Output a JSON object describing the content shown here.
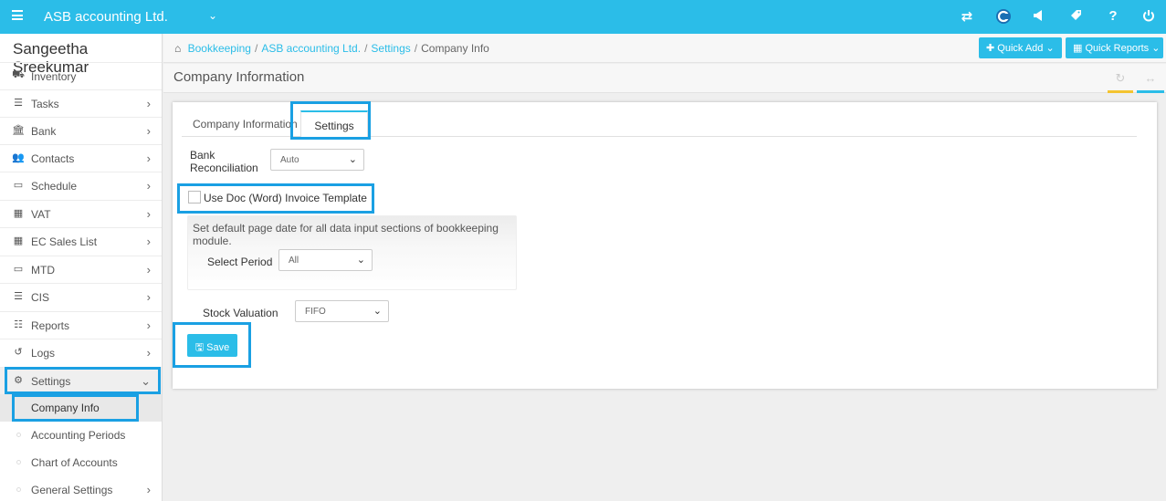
{
  "app": {
    "company": "ASB accounting Ltd.",
    "caret": "⌄",
    "menu_icon": "hamburger-icon",
    "top_icons": [
      "swap-icon",
      "c-logo-icon",
      "megaphone-icon",
      "tag-icon",
      "help-icon",
      "power-icon"
    ],
    "accent": "#2bbde8"
  },
  "sidebar": {
    "user": "Sangeetha Sreekumar",
    "items": [
      {
        "label": "Inventory",
        "icon": "truck-icon",
        "arrow": ""
      },
      {
        "label": "Tasks",
        "icon": "tasks-icon",
        "arrow": "›"
      },
      {
        "label": "Bank",
        "icon": "bank-icon",
        "arrow": "›"
      },
      {
        "label": "Contacts",
        "icon": "users-icon",
        "arrow": "›"
      },
      {
        "label": "Schedule",
        "icon": "calendar-icon",
        "arrow": "›"
      },
      {
        "label": "VAT",
        "icon": "calculator-icon",
        "arrow": "›"
      },
      {
        "label": "EC Sales List",
        "icon": "calculator-icon",
        "arrow": "›"
      },
      {
        "label": "MTD",
        "icon": "calendar-icon",
        "arrow": "›"
      },
      {
        "label": "CIS",
        "icon": "list-icon",
        "arrow": "›"
      },
      {
        "label": "Reports",
        "icon": "list-icon",
        "arrow": "›"
      },
      {
        "label": "Logs",
        "icon": "history-icon",
        "arrow": "›"
      },
      {
        "label": "Settings",
        "icon": "gears-icon",
        "arrow": "⌄"
      }
    ],
    "subitems": [
      {
        "label": "Company Info",
        "arrow": ""
      },
      {
        "label": "Accounting Periods",
        "arrow": ""
      },
      {
        "label": "Chart of Accounts",
        "arrow": ""
      },
      {
        "label": "General Settings",
        "arrow": "›"
      }
    ]
  },
  "breadcrumb": {
    "items": [
      "Bookkeeping",
      "ASB accounting Ltd.",
      "Settings"
    ],
    "current": "Company Info",
    "sep": "/"
  },
  "toolbar": {
    "quick_add": "Quick Add",
    "quick_reports": "Quick Reports"
  },
  "page": {
    "title": "Company Information"
  },
  "tabs": [
    {
      "label": "Company Information",
      "active": false
    },
    {
      "label": "Settings",
      "active": true
    }
  ],
  "form": {
    "bank_label_1": "Bank",
    "bank_label_2": "Reconciliation",
    "bank_value": "Auto",
    "doc_template_label": "Use Doc (Word) Invoice Template",
    "doc_template_checked": false,
    "default_date_text": "Set default page date for all data input sections of bookkeeping module.",
    "period_label": "Select Period",
    "period_value": "All",
    "stock_label": "Stock Valuation",
    "stock_value": "FIFO",
    "save_label": "Save"
  }
}
